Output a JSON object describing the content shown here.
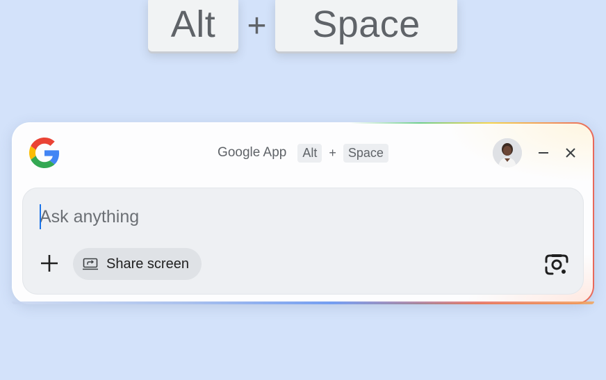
{
  "shortcut": {
    "key1": "Alt",
    "plus": "+",
    "key2": "Space"
  },
  "window": {
    "title": "Google App",
    "shortcut_key1": "Alt",
    "shortcut_plus": "+",
    "shortcut_key2": "Space"
  },
  "search": {
    "placeholder": "Ask anything",
    "value": ""
  },
  "actions": {
    "share_screen_label": "Share screen"
  },
  "icons": {
    "logo": "google-g-icon",
    "minimize": "minimize-icon",
    "close": "close-icon",
    "add": "plus-icon",
    "share": "screen-share-icon",
    "lens": "google-lens-icon"
  },
  "colors": {
    "background": "#d3e2fa",
    "google_blue": "#4285F4",
    "google_red": "#EA4335",
    "google_yellow": "#FBBC05",
    "google_green": "#34A853"
  }
}
